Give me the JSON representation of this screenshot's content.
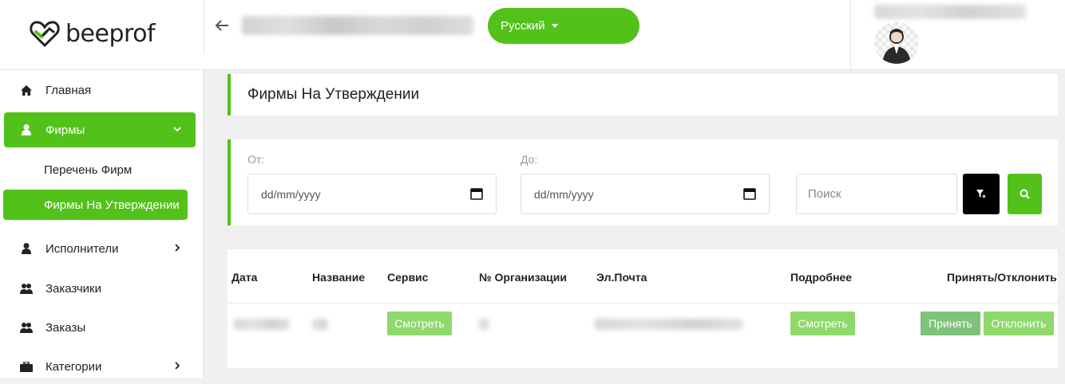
{
  "header": {
    "logo_text": "beeprof",
    "language": "Русский"
  },
  "sidebar": {
    "items": [
      {
        "label": "Главная",
        "icon": "home-icon"
      },
      {
        "label": "Фирмы",
        "icon": "user-icon"
      },
      {
        "label": "Исполнители",
        "icon": "user-icon"
      },
      {
        "label": "Заказчики",
        "icon": "users-icon"
      },
      {
        "label": "Заказы",
        "icon": "users-icon"
      },
      {
        "label": "Категории",
        "icon": "briefcase-icon"
      }
    ],
    "sub_items": [
      {
        "label": "Перечень Фирм"
      },
      {
        "label": "Фирмы На Утверждении"
      }
    ]
  },
  "page": {
    "title": "Фирмы На Утверждении"
  },
  "filters": {
    "from_label": "От:",
    "to_label": "До:",
    "from_value": "dd/mm/yyyy",
    "to_value": "dd/mm/yyyy",
    "search_placeholder": "Поиск"
  },
  "table": {
    "columns": [
      "Дата",
      "Название",
      "Сервис",
      "№ Организации",
      "Эл.Почта",
      "Подробнее",
      "Принять/Отклонить"
    ],
    "rows": [
      {
        "service_btn": "Смотреть",
        "details_btn": "Смотреть",
        "accept_btn": "Принять",
        "reject_btn": "Отклонить"
      }
    ]
  },
  "colors": {
    "accent": "#52c21a",
    "button_light": "#8fd86b",
    "accept": "#7fc27a"
  }
}
